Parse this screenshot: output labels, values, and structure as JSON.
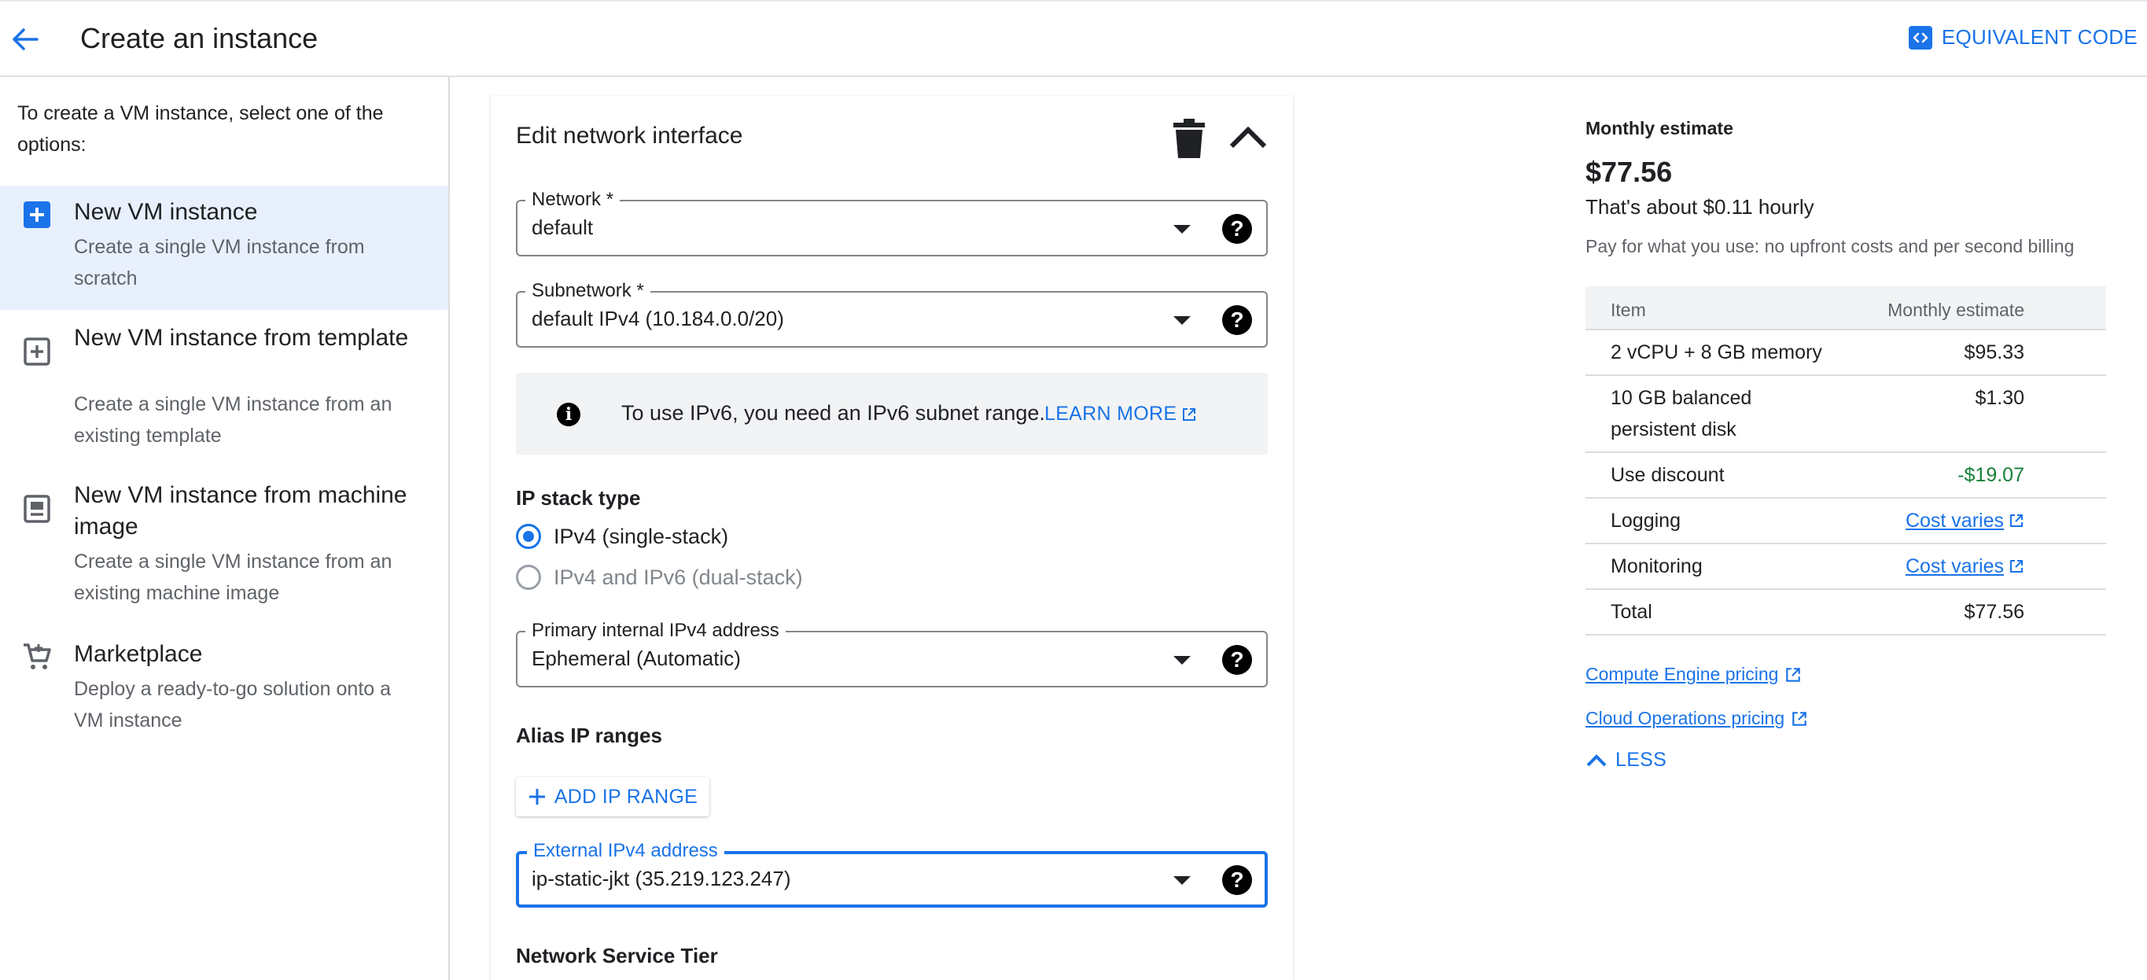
{
  "header": {
    "title": "Create an instance",
    "equivalent_code_label": "EQUIVALENT CODE"
  },
  "sidebar": {
    "intro": "To create a VM instance, select one of the options:",
    "options": [
      {
        "title": "New VM instance",
        "desc": "Create a single VM instance from scratch",
        "icon": "add-box-icon",
        "selected": true
      },
      {
        "title": "New VM instance from template",
        "desc": "Create a single VM instance from an existing template",
        "icon": "template-icon",
        "selected": false
      },
      {
        "title": "New VM instance from machine image",
        "desc": "Create a single VM instance from an existing machine image",
        "icon": "machine-image-icon",
        "selected": false
      },
      {
        "title": "Marketplace",
        "desc": "Deploy a ready-to-go solution onto a VM instance",
        "icon": "shopping-cart-icon",
        "selected": false
      }
    ]
  },
  "form": {
    "title": "Edit network interface",
    "network": {
      "label": "Network *",
      "value": "default"
    },
    "subnetwork": {
      "label": "Subnetwork *",
      "value": "default IPv4 (10.184.0.0/20)"
    },
    "info": {
      "text": "To use IPv6, you need an IPv6 subnet range.",
      "link": "LEARN MORE"
    },
    "ip_stack": {
      "label": "IP stack type",
      "options": [
        {
          "label": "IPv4 (single-stack)",
          "checked": true,
          "disabled": false
        },
        {
          "label": "IPv4 and IPv6 (dual-stack)",
          "checked": false,
          "disabled": true
        }
      ]
    },
    "primary_ip": {
      "label": "Primary internal IPv4 address",
      "value": "Ephemeral (Automatic)"
    },
    "alias": {
      "label": "Alias IP ranges",
      "button": "ADD IP RANGE"
    },
    "external_ip": {
      "label": "External IPv4 address",
      "value": "ip-static-jkt (35.219.123.247)"
    },
    "tier_label": "Network Service Tier"
  },
  "estimate": {
    "label": "Monthly estimate",
    "price": "$77.56",
    "hourly": "That's about $0.11 hourly",
    "note": "Pay for what you use: no upfront costs and per second billing",
    "table": {
      "headers": [
        "Item",
        "Monthly estimate"
      ],
      "rows": [
        {
          "item": "2 vCPU + 8 GB memory",
          "value": "$95.33"
        },
        {
          "item": "10 GB balanced persistent disk",
          "value": "$1.30"
        },
        {
          "item": "Use discount",
          "value": "-$19.07"
        },
        {
          "item": "Logging",
          "value": "Cost varies"
        },
        {
          "item": "Monitoring",
          "value": "Cost varies"
        },
        {
          "item": "Total",
          "value": "$77.56"
        }
      ]
    },
    "links": [
      "Compute Engine pricing",
      "Cloud Operations pricing"
    ],
    "less_label": "LESS"
  },
  "colors": {
    "accent": "#1a73e8",
    "selected_bg": "#e8f0fe",
    "discount": "#188038"
  }
}
